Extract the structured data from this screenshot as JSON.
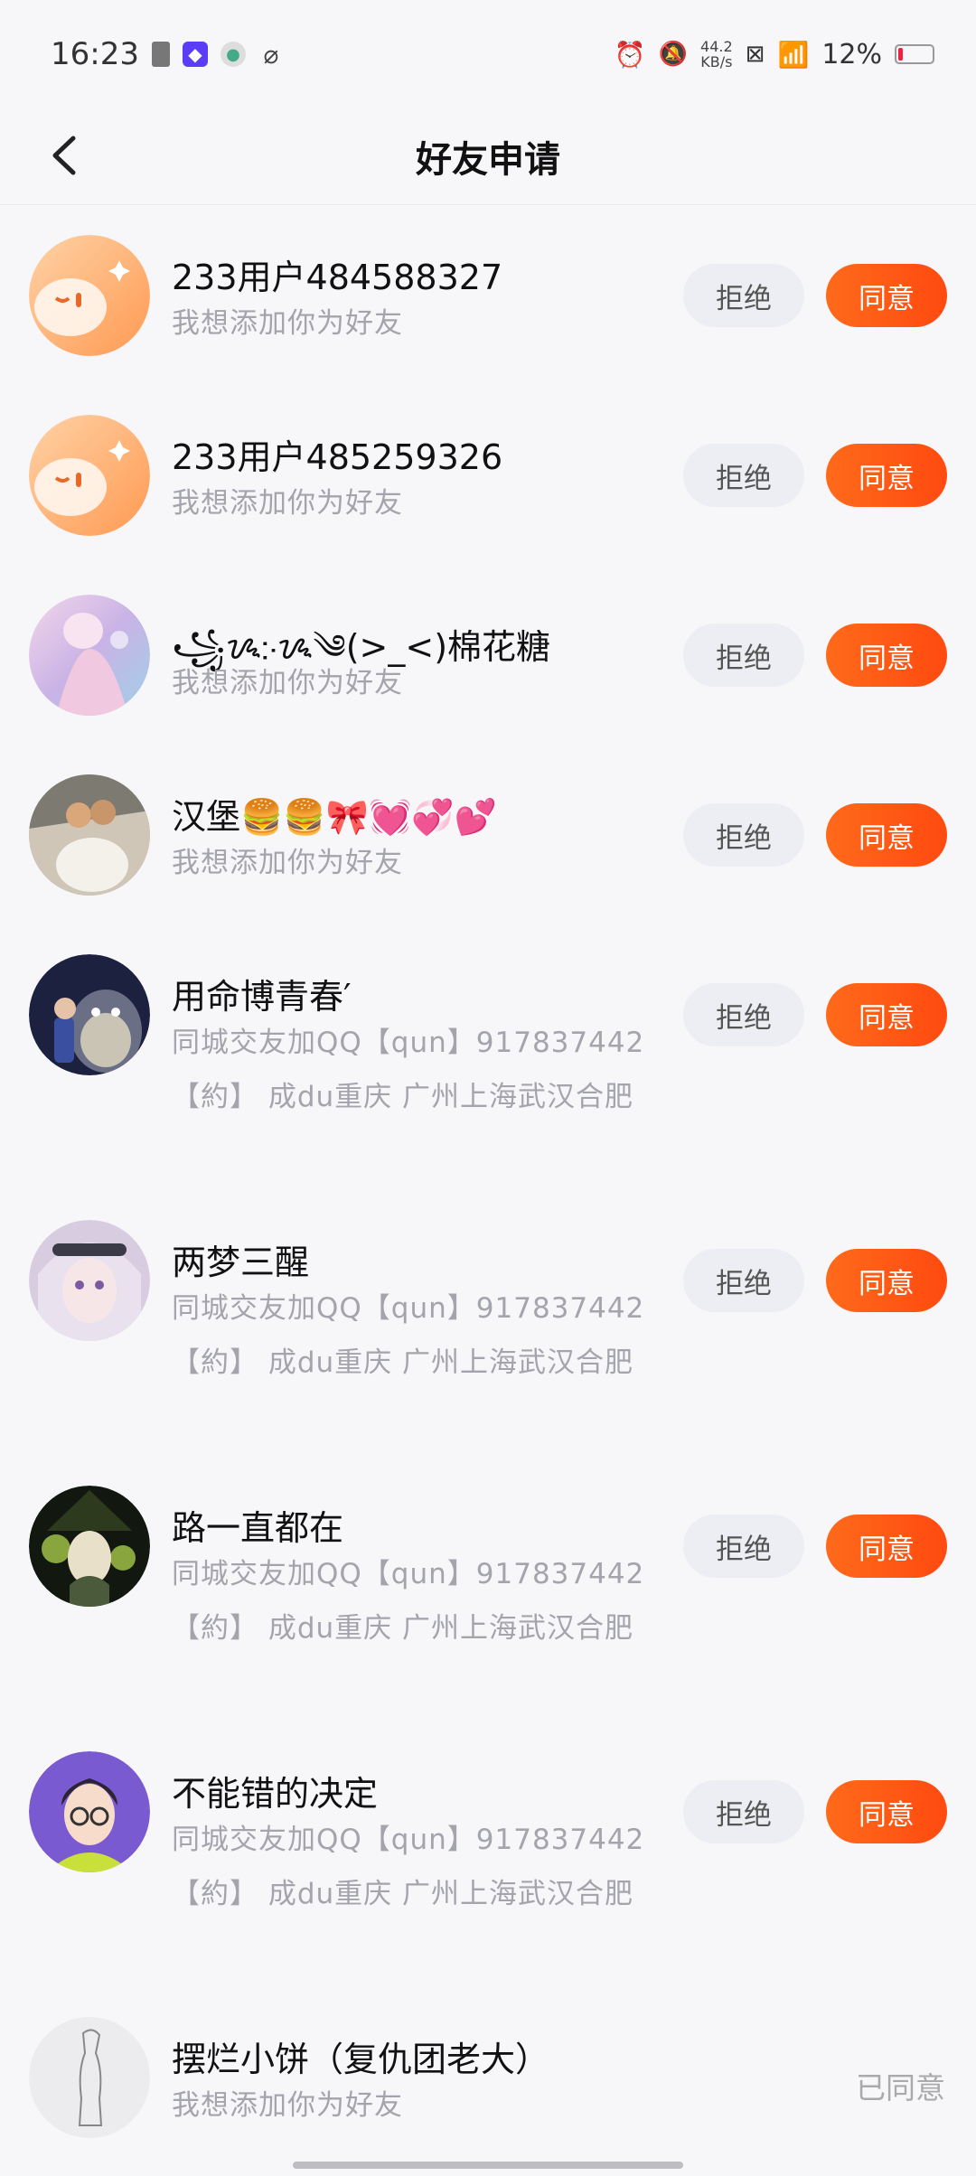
{
  "status_bar": {
    "time": "16:23",
    "net_speed_value": "44.2",
    "net_speed_unit": "KB/s",
    "battery": "12%"
  },
  "header": {
    "title": "好友申请"
  },
  "buttons": {
    "reject": "拒绝",
    "accept": "同意",
    "accepted": "已同意"
  },
  "requests": [
    {
      "name": "233用户484588327",
      "message": "我想添加你为好友",
      "status": "pending",
      "avatar": "orange-face"
    },
    {
      "name": "233用户485259326",
      "message": "我想添加你为好友",
      "status": "pending",
      "avatar": "orange-face"
    },
    {
      "name": "꧁ᝰ჻ᝰ༄(>_<)棉花糖",
      "message": "我想添加你为好友",
      "status": "pending",
      "avatar": "pink-anime"
    },
    {
      "name": "汉堡🍔🍔🎀💓💞💕",
      "message": "我想添加你为好友",
      "status": "pending",
      "avatar": "dogs-photo"
    },
    {
      "name": "用命博青春′",
      "message": "同城交友加QQ【qun】917837442【約】 成du重庆 广州上海武汉合肥",
      "status": "pending",
      "avatar": "totoro"
    },
    {
      "name": "两梦三醒",
      "message": "同城交友加QQ【qun】917837442【約】 成du重庆 广州上海武汉合肥",
      "status": "pending",
      "avatar": "anime-girl"
    },
    {
      "name": "路一直都在",
      "message": "同城交友加QQ【qun】917837442【約】 成du重庆 广州上海武汉合肥",
      "status": "pending",
      "avatar": "witch"
    },
    {
      "name": "不能错的决定",
      "message": "同城交友加QQ【qun】917837442【約】 成du重庆 广州上海武汉合肥",
      "status": "pending",
      "avatar": "glasses-girl"
    },
    {
      "name": "摆烂小饼（复仇团老大）",
      "message": "我想添加你为好友",
      "status": "accepted",
      "avatar": "sketch"
    }
  ]
}
